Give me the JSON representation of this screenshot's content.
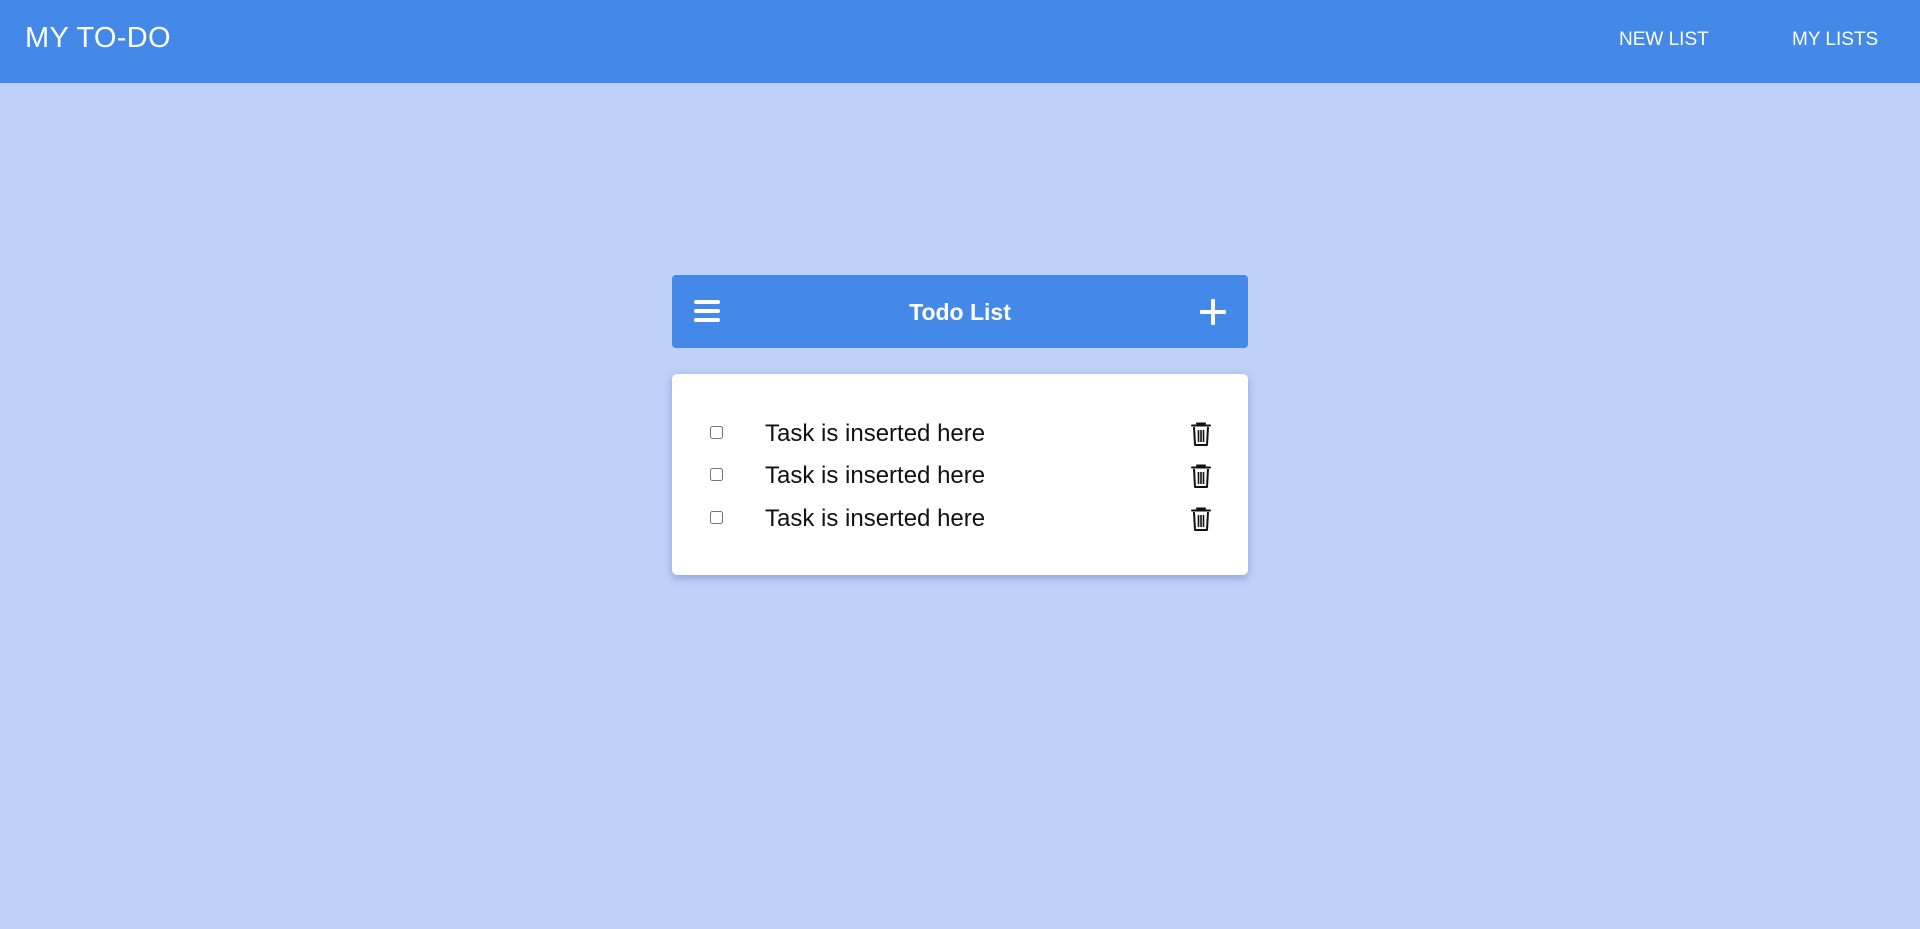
{
  "app": {
    "brand": "MY TO-DO",
    "nav": [
      {
        "label": "NEW LIST"
      },
      {
        "label": "MY LISTS"
      }
    ]
  },
  "list": {
    "title": "Todo List",
    "menu_icon": "hamburger-menu-icon",
    "add_icon": "plus-icon",
    "tasks": [
      {
        "text": "Task is inserted here",
        "checked": false
      },
      {
        "text": "Task is inserted here",
        "checked": false
      },
      {
        "text": "Task is inserted here",
        "checked": false
      }
    ]
  },
  "colors": {
    "primary": "#4489e8",
    "background": "#bfd0f9",
    "card": "#ffffff"
  }
}
